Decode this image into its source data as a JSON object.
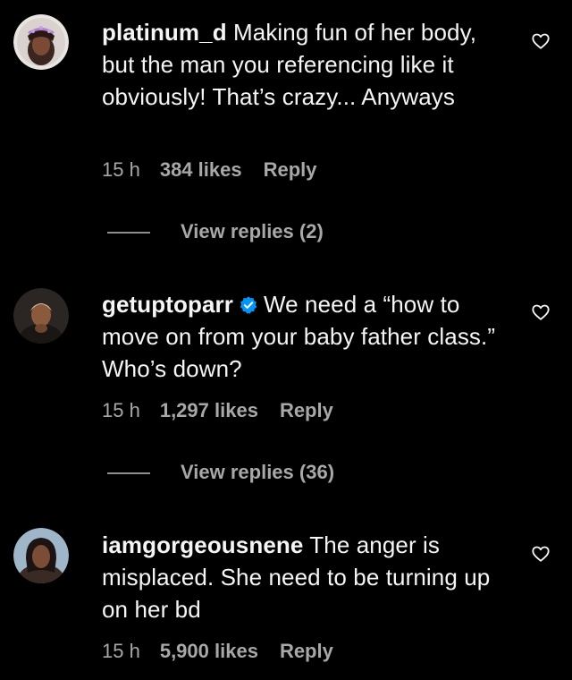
{
  "comments": [
    {
      "username": "platinum_d",
      "verified": false,
      "text": "Making fun of her body, but the man you referencing like it obviously! That’s crazy... Anyways",
      "time": "15 h",
      "likes": "384 likes",
      "reply": "Reply",
      "view_replies": "View replies (2)",
      "avatar_icon": "avatar-photo"
    },
    {
      "username": "getuptoparr",
      "verified": true,
      "text": "We need a “how to move on from your baby father class.” Who’s down?",
      "time": "15 h",
      "likes": "1,297 likes",
      "reply": "Reply",
      "view_replies": "View replies (36)",
      "avatar_icon": "avatar-photo"
    },
    {
      "username": "iamgorgeousnene",
      "verified": false,
      "text": "The anger is misplaced. She need to be turning up on her bd",
      "time": "15 h",
      "likes": "5,900 likes",
      "reply": "Reply",
      "avatar_icon": "avatar-photo"
    }
  ],
  "colors": {
    "background": "#000000",
    "text": "#f5f5f5",
    "secondary": "#a8a8a8",
    "verified_badge": "#0095f6"
  }
}
